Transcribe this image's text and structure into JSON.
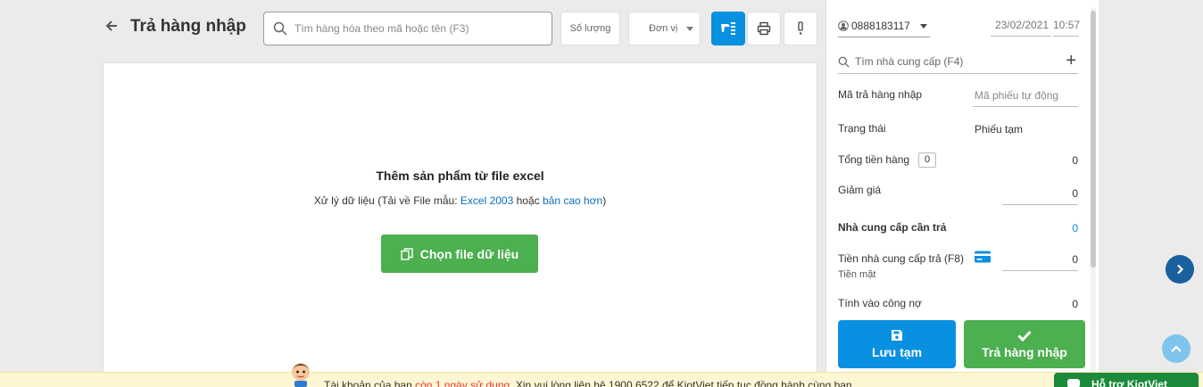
{
  "header": {
    "title": "Trả hàng nhập",
    "search_placeholder": "Tìm hàng hóa theo mã hoặc tên (F3)",
    "qty_label": "Số lượng",
    "unit_label": "Đơn vị"
  },
  "import": {
    "title": "Thêm sản phẩm từ file excel",
    "desc_prefix": "Xử lý dữ liệu (Tải về File mẫu: ",
    "link_excel2003": "Excel 2003",
    "desc_or": " hoặc ",
    "link_newer": "bản cao hơn",
    "desc_suffix": ")",
    "button_label": "Chọn file dữ liệu"
  },
  "panel": {
    "user": "0888183117",
    "date": "23/02/2021",
    "time": "10:57",
    "supplier_search_placeholder": "Tìm nhà cung cấp (F4)",
    "code_label": "Mã trả hàng nhập",
    "code_placeholder": "Mã phiếu tự động",
    "status_label": "Trạng thái",
    "status_value": "Phiếu tạm",
    "total_label": "Tổng tiền hàng",
    "total_count": "0",
    "total_value": "0",
    "discount_label": "Giảm giá",
    "discount_value": "0",
    "supplier_due_label": "Nhà cung cấp cần trả",
    "supplier_due_value": "0",
    "supplier_paid_label": "Tiền nhà cung cấp trả (F8)",
    "payment_method": "Tiền mặt",
    "supplier_paid_value": "0",
    "debt_label": "Tính vào công nợ",
    "debt_value": "0",
    "save_label": "Lưu tạm",
    "return_label": "Trả hàng nhập"
  },
  "notice": {
    "prefix": "Tài khoản của bạn ",
    "highlight": "còn 1 ngày sử dụng",
    "suffix": ". Xin vui lòng liên hệ 1900 6522 để KiotViet tiếp tục đồng hành cùng bạn."
  },
  "support_label": "Hỗ trợ KiotViet",
  "colors": {
    "primary": "#0a90e0",
    "success": "#4caf50",
    "link": "#0a6ebd",
    "warning_text": "#e53935"
  }
}
